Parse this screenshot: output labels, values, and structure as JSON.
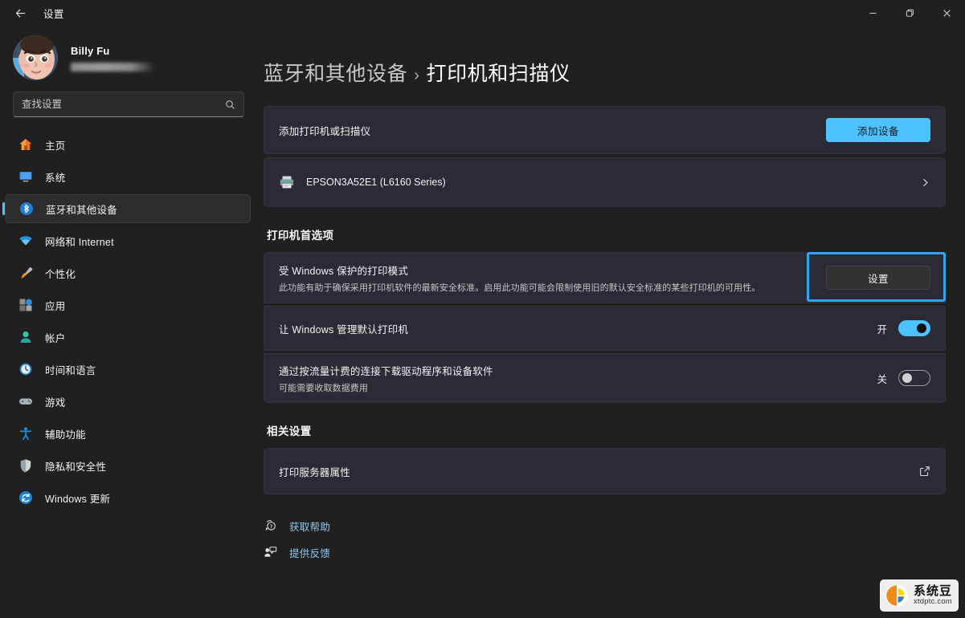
{
  "titlebar": {
    "back_label": "back-arrow",
    "app_title": "设置",
    "minimize": "minimize",
    "maximize": "restore",
    "close": "close"
  },
  "sidebar": {
    "account": {
      "name": "Billy Fu",
      "email_redacted": ""
    },
    "search": {
      "placeholder": "查找设置",
      "value": ""
    },
    "items": [
      {
        "icon": "home-icon",
        "label": "主页",
        "selected": false
      },
      {
        "icon": "system-icon",
        "label": "系统",
        "selected": false
      },
      {
        "icon": "bluetooth-icon",
        "label": "蓝牙和其他设备",
        "selected": true
      },
      {
        "icon": "network-icon",
        "label": "网络和 Internet",
        "selected": false
      },
      {
        "icon": "personalize-icon",
        "label": "个性化",
        "selected": false
      },
      {
        "icon": "apps-icon",
        "label": "应用",
        "selected": false
      },
      {
        "icon": "accounts-icon",
        "label": "帐户",
        "selected": false
      },
      {
        "icon": "time-icon",
        "label": "时间和语言",
        "selected": false
      },
      {
        "icon": "gaming-icon",
        "label": "游戏",
        "selected": false
      },
      {
        "icon": "accessibility-icon",
        "label": "辅助功能",
        "selected": false
      },
      {
        "icon": "privacy-icon",
        "label": "隐私和安全性",
        "selected": false
      },
      {
        "icon": "update-icon",
        "label": "Windows 更新",
        "selected": false
      }
    ]
  },
  "main": {
    "breadcrumb": {
      "parent": "蓝牙和其他设备",
      "separator": "›",
      "current": "打印机和扫描仪"
    },
    "add_printer": {
      "title": "添加打印机或扫描仪",
      "button": "添加设备"
    },
    "printer": {
      "name": "EPSON3A52E1 (L6160 Series)"
    },
    "preferences_heading": "打印机首选项",
    "protected_print": {
      "title": "受 Windows 保护的打印模式",
      "description": "此功能有助于确保采用打印机软件的最新安全标准。启用此功能可能会限制使用旧的默认安全标准的某些打印机的可用性。",
      "button": "设置"
    },
    "manage_default": {
      "title": "让 Windows 管理默认打印机",
      "state": "开",
      "on": true
    },
    "metered_download": {
      "title": "通过按流量计费的连接下载驱动程序和设备软件",
      "description": "可能需要收取数据费用",
      "state": "关",
      "on": false
    },
    "related_heading": "相关设置",
    "print_server": {
      "title": "打印服务器属性"
    },
    "footer_links": [
      {
        "icon": "help-icon",
        "label": "获取帮助"
      },
      {
        "icon": "feedback-icon",
        "label": "提供反馈"
      }
    ]
  },
  "watermark": {
    "name": "系统豆",
    "url": "xtdptc.com"
  },
  "colors": {
    "accent": "#4cc2ff",
    "highlight_box": "#35a3e8",
    "link": "#8fc8f0",
    "card_bg": "#2b2b36",
    "window_bg": "#202020"
  }
}
